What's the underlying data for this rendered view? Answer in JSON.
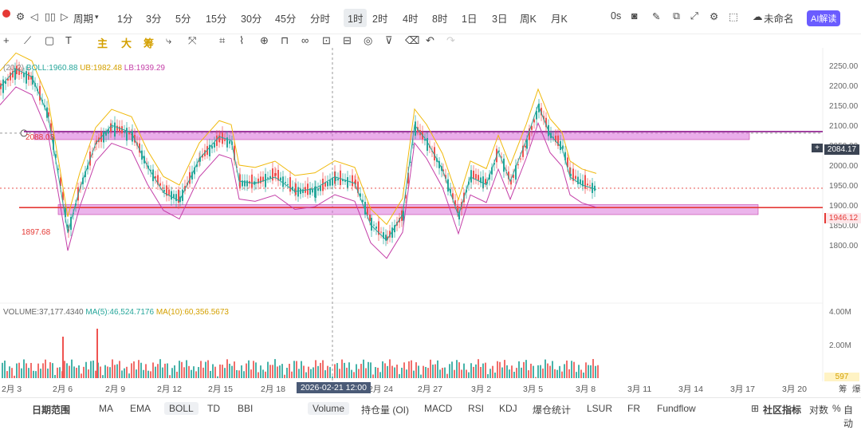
{
  "toolbar": {
    "period_label": "周期",
    "intervals": [
      "1分",
      "3分",
      "5分",
      "15分",
      "30分",
      "45分",
      "分时",
      "1时",
      "2时",
      "4时",
      "8时",
      "1日",
      "3日",
      "周K",
      "月K"
    ],
    "active_interval": "1时",
    "right_items": [
      "0s",
      "未命名"
    ],
    "ai_label": "AI解读"
  },
  "drawing_tools": {
    "labels": [
      "主",
      "大",
      "筹"
    ]
  },
  "indicators": {
    "boll_legend": {
      "params": "(20,2)",
      "boll_label": "BOLL:1960.88",
      "ub_label": "UB:1982.48",
      "lb_label": "LB:1939.29"
    },
    "volume_legend": {
      "volume_label": "VOLUME:37,177.4340",
      "ma5_label": "MA(5):46,524.7176",
      "ma10_label": "MA(10):60,356.5673"
    }
  },
  "price_axis": {
    "ticks": [
      "2250.00",
      "2200.00",
      "2150.00",
      "2100.00",
      "2050.00",
      "2000.00",
      "1950.00",
      "1900.00",
      "1850.00",
      "1800.00"
    ],
    "current_price": "1946.12",
    "crosshair_price": "2084.17",
    "level_upper": "2088.03",
    "level_lower": "1897.68"
  },
  "volume_axis": {
    "ticks": [
      "4.00M",
      "2.00M"
    ],
    "last_value": "597"
  },
  "time_axis": {
    "labels": [
      "2月 3",
      "2月 6",
      "2月 9",
      "2月 12",
      "2月 15",
      "2月 18",
      "2月 24",
      "2月 27",
      "3月 2",
      "3月 5",
      "3月 8",
      "3月 11",
      "3月 14",
      "3月 17",
      "3月 20"
    ],
    "crosshair_time": "2026-02-21 12:00",
    "overflow_labels": [
      "筹",
      "爆"
    ]
  },
  "bottom_bar": {
    "left_label": "日期范围",
    "main_indicators": [
      "MA",
      "EMA",
      "BOLL",
      "TD",
      "BBI"
    ],
    "active_main": "BOLL",
    "sub_indicators": [
      "Volume",
      "持仓量 (OI)",
      "MACD",
      "RSI",
      "KDJ",
      "爆仓统计",
      "LSUR",
      "FR",
      "Fundflow"
    ],
    "active_sub": "Volume",
    "right_label": "社区指标",
    "right_items": [
      "对数",
      "%",
      "自动"
    ]
  },
  "colors": {
    "up": "#26a69a",
    "down": "#ef5350",
    "boll_mid": "#26a69a",
    "boll_ub": "#f0b90b",
    "boll_lb": "#c43fa8",
    "zone_fill": "#d86ad8",
    "level_line": "#e53935",
    "ai_btn": "#6a5cff"
  }
}
